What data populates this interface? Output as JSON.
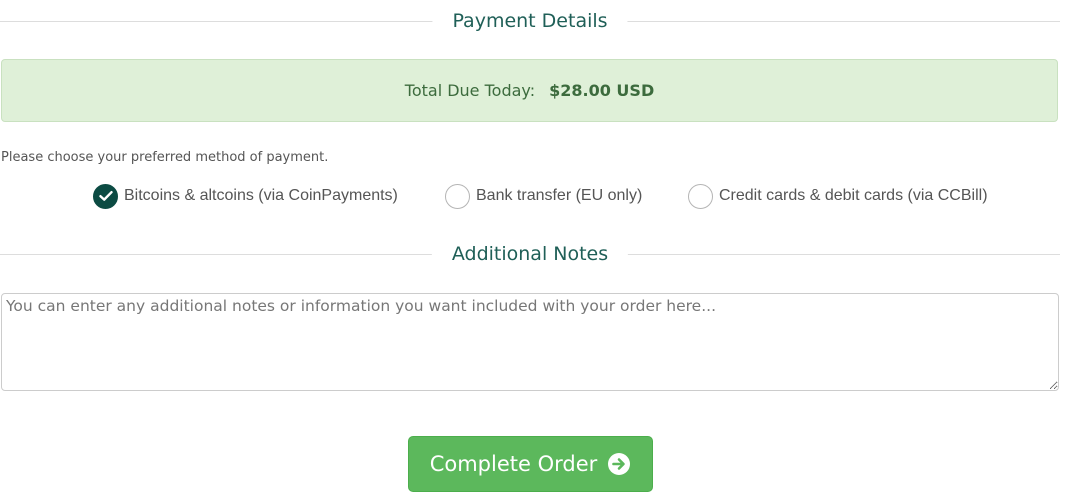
{
  "payment_section": {
    "heading": "Payment Details",
    "total_label": "Total Due Today:",
    "total_amount": "$28.00 USD",
    "instruction": "Please choose your preferred method of payment.",
    "methods": [
      {
        "label": "Bitcoins & altcoins (via CoinPayments)",
        "selected": true
      },
      {
        "label": "Bank transfer (EU only)",
        "selected": false
      },
      {
        "label": "Credit cards & debit cards (via CCBill)",
        "selected": false
      }
    ]
  },
  "notes_section": {
    "heading": "Additional Notes",
    "placeholder": "You can enter any additional notes or information you want included with your order here...",
    "value": ""
  },
  "actions": {
    "complete_label": "Complete Order"
  },
  "colors": {
    "accent_dark": "#0c4b43",
    "heading_text": "#1f5f57",
    "success_bg": "#dff0d8",
    "button_green": "#5cb85c"
  }
}
